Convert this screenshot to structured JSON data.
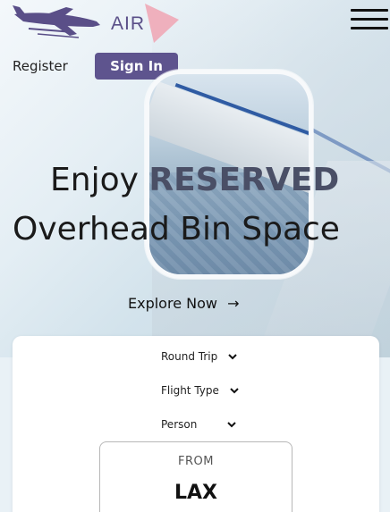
{
  "brand": {
    "name": "AIR",
    "accent": "#5e548e",
    "tail_color": "#f0a4b3"
  },
  "nav": {
    "register_label": "Register",
    "signin_label": "Sign In",
    "menu_icon": "hamburger-icon"
  },
  "hero": {
    "headline_prefix": "Enjoy",
    "headline_highlight": "RESERVED",
    "headline_line2": "Overhead Bin Space",
    "cta_label": "Explore Now",
    "cta_arrow": "→"
  },
  "booking": {
    "trip_type": "Round Trip",
    "flight_type": "Flight Type",
    "person": "Person",
    "chevron": "⌄",
    "from_label": "FROM",
    "from_code": "LAX"
  }
}
